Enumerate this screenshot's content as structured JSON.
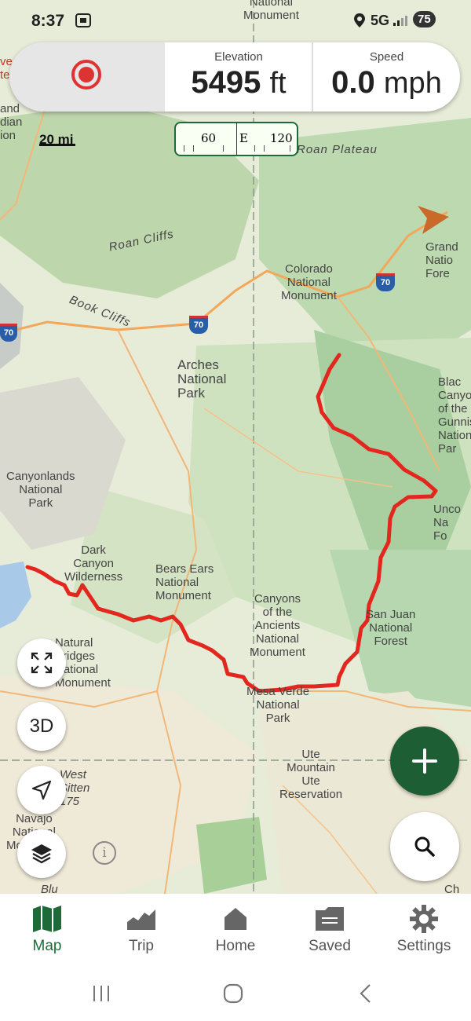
{
  "status_bar": {
    "time": "8:37",
    "network": "5G",
    "battery": "75"
  },
  "hud": {
    "elevation": {
      "label": "Elevation",
      "value": "5495",
      "unit": "ft"
    },
    "speed": {
      "label": "Speed",
      "value": "0.0",
      "unit": "mph"
    }
  },
  "scale": {
    "label": "20 mi"
  },
  "compass": {
    "left": "60",
    "center": "E",
    "right": "120"
  },
  "map_labels": {
    "national_monument_top": "National\nMonument",
    "roan_plateau": "Roan Plateau",
    "roan_cliffs": "Roan Cliffs",
    "book_cliffs": "Book Cliffs",
    "colorado_nm": "Colorado\nNational\nMonument",
    "grand_mesa": "Grand\nNatio\nFore",
    "arches": "Arches\nNational\nPark",
    "black_canyon": "Blac\nCanyo\nof the\nGunniso\nNation\nPar",
    "canyonlands": "Canyonlands\nNational\nPark",
    "uncompahgre": "Unco\nNa\nFo",
    "dark_canyon": "Dark\nCanyon\nWilderness",
    "bears_ears": "Bears Ears\nNational\nMonument",
    "canyons_ancients": "Canyons\nof the\nAncients\nNational\nMonument",
    "san_juan": "San Juan\nNational\nForest",
    "natural_bridges": "Natural\nBridges\nNational\nMonument",
    "mesa_verde": "Mesa Verde\nNational\nPark",
    "ute_mountain": "Ute\nMountain\nUte\nReservation",
    "west_sitten": "West\nSitten\n175",
    "navajo": "Navajo\nNational\nMonument",
    "and_indian": "and\ndian\nion",
    "left_edge": "ve\nte",
    "bottom_left": "Blu",
    "bottom_right": "Ch"
  },
  "highways": {
    "i70_a": "70",
    "i70_b": "70",
    "i70_c": "70"
  },
  "buttons": {
    "three_d": "3D"
  },
  "nav": [
    {
      "label": "Map",
      "icon": "map-icon"
    },
    {
      "label": "Trip",
      "icon": "chart-icon"
    },
    {
      "label": "Home",
      "icon": "home-icon"
    },
    {
      "label": "Saved",
      "icon": "folder-icon"
    },
    {
      "label": "Settings",
      "icon": "gear-icon"
    }
  ],
  "colors": {
    "accent": "#1e6b3a",
    "track": "#e3271f",
    "record": "#d33333"
  }
}
